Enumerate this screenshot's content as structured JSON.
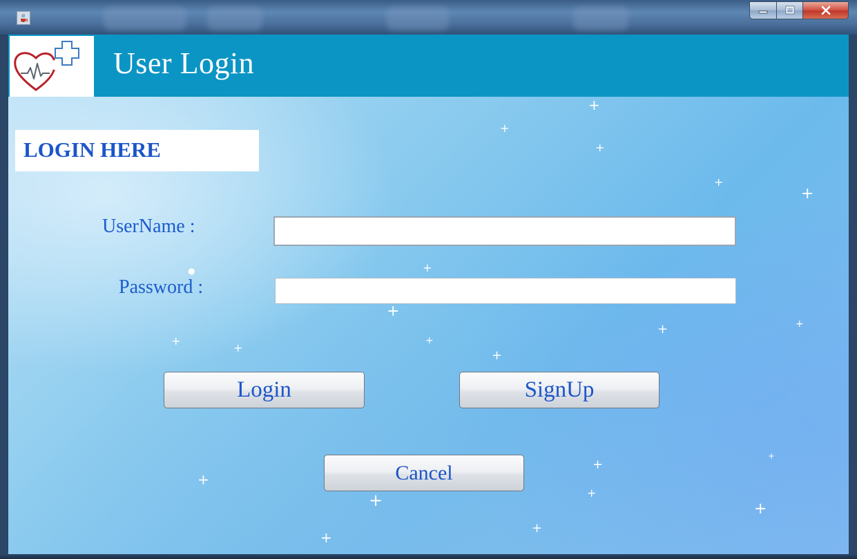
{
  "window": {
    "app_icon": "java-cup-icon",
    "controls": {
      "minimize_icon": "minimize-icon",
      "maximize_icon": "maximize-icon",
      "close_icon": "close-icon"
    }
  },
  "header": {
    "logo_icon": "heart-cross-medical-logo",
    "title": "User Login",
    "background": "#0b95c4"
  },
  "form": {
    "section_title": "LOGIN HERE",
    "username_label": "UserName :",
    "username_value": "",
    "password_label": "Password :",
    "password_value": ""
  },
  "buttons": {
    "login": "Login",
    "signup": "SignUp",
    "cancel": "Cancel"
  },
  "colors": {
    "label_text": "#1c5ccc",
    "header_bar": "#0b95c4",
    "close_button": "#c0392b"
  }
}
